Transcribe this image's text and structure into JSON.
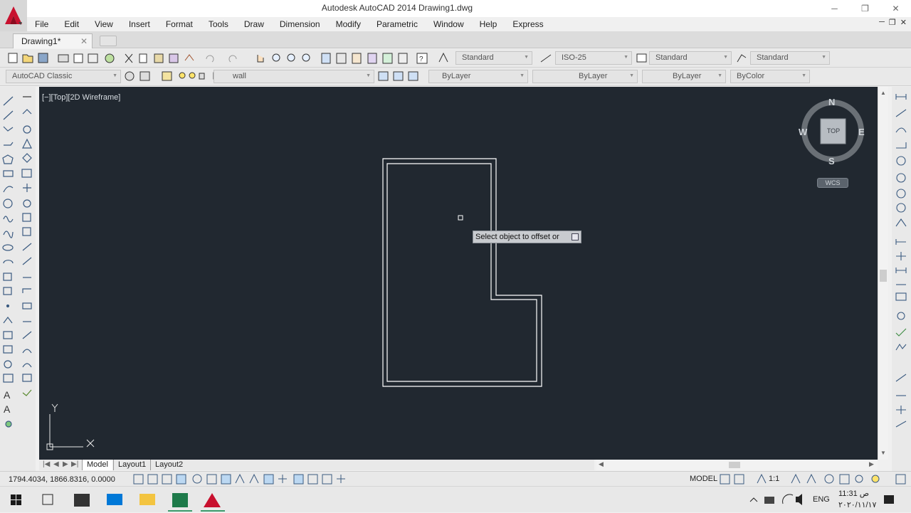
{
  "window": {
    "title": "Autodesk AutoCAD 2014    Drawing1.dwg",
    "controls": {
      "minimize": "─",
      "maximize": "❐",
      "close": "✕"
    },
    "mdi_controls": {
      "minimize": "─",
      "restore": "❐",
      "close": "✕"
    }
  },
  "menu": [
    "File",
    "Edit",
    "View",
    "Insert",
    "Format",
    "Tools",
    "Draw",
    "Dimension",
    "Modify",
    "Parametric",
    "Window",
    "Help",
    "Express"
  ],
  "doc_tab": {
    "label": "Drawing1*",
    "close": "✕"
  },
  "styles_toolbar": {
    "text_style": "Standard",
    "dim_style": "ISO-25",
    "table_style": "Standard",
    "mleader_style": "Standard"
  },
  "workspace": {
    "name": "AutoCAD Classic"
  },
  "layer": {
    "current": "wall"
  },
  "properties": {
    "color": "ByLayer",
    "linetype": "ByLayer",
    "lineweight": "ByLayer",
    "plotstyle": "ByColor"
  },
  "viewport": {
    "label": "[−][Top][2D Wireframe]",
    "prompt": "Select object to offset or",
    "ucs": {
      "y": "Y",
      "x": "X"
    }
  },
  "viewcube": {
    "n": "N",
    "s": "S",
    "e": "E",
    "w": "W",
    "face": "TOP",
    "wcs": "WCS"
  },
  "layout_tabs": [
    "Model",
    "Layout1",
    "Layout2"
  ],
  "status": {
    "coords": "1794.4034, 1866.8316, 0.0000",
    "space": "MODEL",
    "annotation_scale": "1:1"
  },
  "tray": {
    "lang": "ENG",
    "time": "11:31 ص",
    "date": "۲۰۲۰/۱۱/۱۷"
  },
  "colors": {
    "viewport_bg": "#212830",
    "line": "#ffffff",
    "accent": "#c8102e"
  }
}
